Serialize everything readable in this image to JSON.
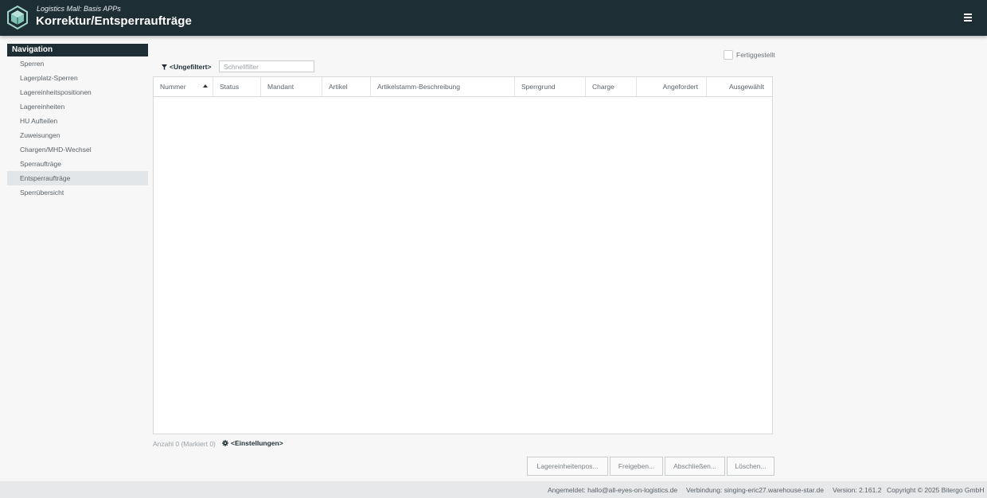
{
  "header": {
    "subtitle": "Logistics Mall: Basis APPs",
    "title": "Korrektur/Entsperraufträge",
    "logo_icon": "cube-icon",
    "menu_icon": "hamburger-menu-icon",
    "background": "#1e2e35"
  },
  "sidebar": {
    "header": "Navigation",
    "items": [
      {
        "label": "Sperren"
      },
      {
        "label": "Lagerplatz-Sperren"
      },
      {
        "label": "Lagereinheitspositionen"
      },
      {
        "label": "Lagereinheiten"
      },
      {
        "label": "HU Aufteilen"
      },
      {
        "label": "Zuweisungen"
      },
      {
        "label": "Chargen/MHD-Wechsel"
      },
      {
        "label": "Sperraufträge"
      },
      {
        "label": "Entsperraufträge",
        "active": true
      },
      {
        "label": "Sperrübersicht"
      }
    ]
  },
  "filter": {
    "label": "<Ungefiltert>",
    "icon": "filter-icon",
    "quick_filter_placeholder": "Schnellfilter",
    "quick_filter_value": "",
    "finished_label": "Fertiggestellt",
    "finished_checked": false
  },
  "table": {
    "columns": [
      {
        "label": "Nummer",
        "sorted": "asc"
      },
      {
        "label": "Status"
      },
      {
        "label": "Mandant"
      },
      {
        "label": "Artikel"
      },
      {
        "label": "Artikelstamm-Beschreibung"
      },
      {
        "label": "Sperrgrund"
      },
      {
        "label": "Charge"
      },
      {
        "label": "Angefordert"
      },
      {
        "label": "Ausgewählt"
      }
    ],
    "rows": []
  },
  "table_footer": {
    "count_text": "Anzahl 0 (Markiert 0)",
    "settings_label": "<Einstellungen>",
    "settings_icon": "gear-icon"
  },
  "actions": {
    "lagereinheitenpos": "Lagereinheitenpos...",
    "freigeben": "Freigeben...",
    "abschliessen": "Abschließen...",
    "loeschen": "Löschen..."
  },
  "statusbar": {
    "logged_in": "Angemeldet: hallo@all-eyes-on-logistics.de",
    "connection": "Verbindung: singing-eric27.warehouse-star.de",
    "version": "Version: 2.161.2",
    "copyright": "Copyright © 2025 Bitergo GmbH"
  }
}
